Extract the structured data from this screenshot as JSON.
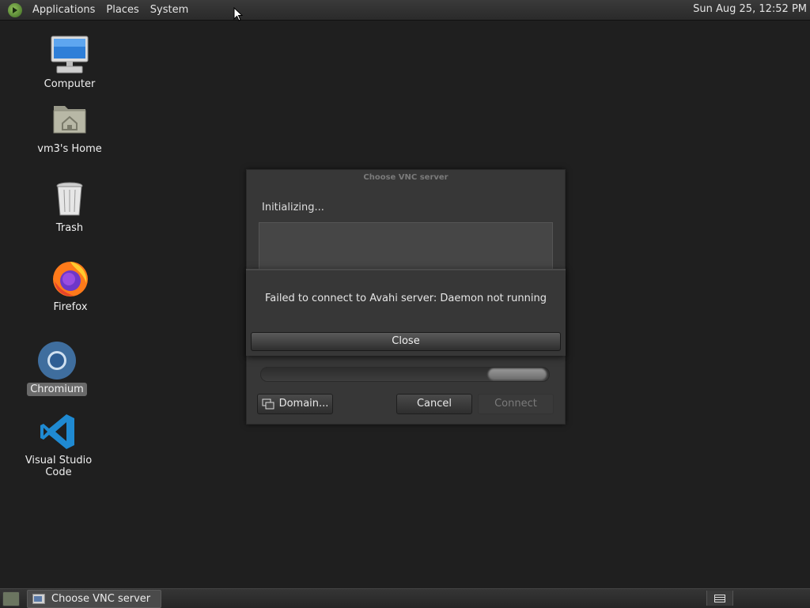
{
  "top_panel": {
    "menus": [
      "Applications",
      "Places",
      "System"
    ],
    "clock": "Sun Aug 25, 12:52 PM"
  },
  "desktop_icons": {
    "computer": "Computer",
    "home": "vm3's Home",
    "trash": "Trash",
    "firefox": "Firefox",
    "chromium": "Chromium",
    "vscode": "Visual Studio Code"
  },
  "vnc_dialog": {
    "title": "Choose VNC server",
    "status": "Initializing...",
    "domain_button": "Domain...",
    "cancel_button": "Cancel",
    "connect_button": "Connect"
  },
  "error_alert": {
    "message": "Failed to connect to Avahi server: Daemon not running",
    "close_button": "Close"
  },
  "taskbar": {
    "window_button": "Choose VNC server"
  },
  "colors": {
    "desktop_bg": "#1f1f1f",
    "dialog_bg": "#373737",
    "selection_label_bg": "#6a6a6a"
  }
}
